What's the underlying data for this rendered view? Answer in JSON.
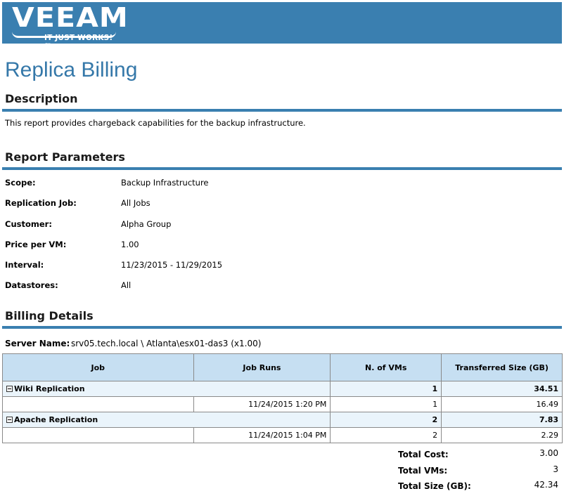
{
  "logo": {
    "word": "VEEAM",
    "tagline": "IT JUST WORKS!™"
  },
  "title": "Replica Billing",
  "description": {
    "heading": "Description",
    "text": "This report provides chargeback capabilities for the backup infrastructure."
  },
  "parameters": {
    "heading": "Report Parameters",
    "items": [
      {
        "label": "Scope:",
        "value": "Backup Infrastructure"
      },
      {
        "label": "Replication Job:",
        "value": "All Jobs"
      },
      {
        "label": "Customer:",
        "value": "Alpha Group"
      },
      {
        "label": "Price per VM:",
        "value": "1.00"
      },
      {
        "label": "Interval:",
        "value": "11/23/2015 - 11/29/2015"
      },
      {
        "label": "Datastores:",
        "value": "All"
      }
    ]
  },
  "billing": {
    "heading": "Billing Details",
    "server_label": "Server Name:",
    "server_value": "srv05.tech.local \\ Atlanta\\esx01-das3 (x1.00)",
    "columns": [
      "Job",
      "Job Runs",
      "N. of VMs",
      "Transferred Size (GB)"
    ],
    "groups": [
      {
        "job": "Wiki Replication",
        "vms": "1",
        "size": "34.51",
        "runs": [
          {
            "time": "11/24/2015 1:20 PM",
            "vms": "1",
            "size": "16.49"
          }
        ]
      },
      {
        "job": "Apache Replication",
        "vms": "2",
        "size": "7.83",
        "runs": [
          {
            "time": "11/24/2015 1:04 PM",
            "vms": "2",
            "size": "2.29"
          }
        ]
      }
    ]
  },
  "summary": [
    {
      "label": "Total Cost:",
      "value": "3.00"
    },
    {
      "label": "Total VMs:",
      "value": "3"
    },
    {
      "label": "Total Size (GB):",
      "value": "42.34"
    }
  ]
}
